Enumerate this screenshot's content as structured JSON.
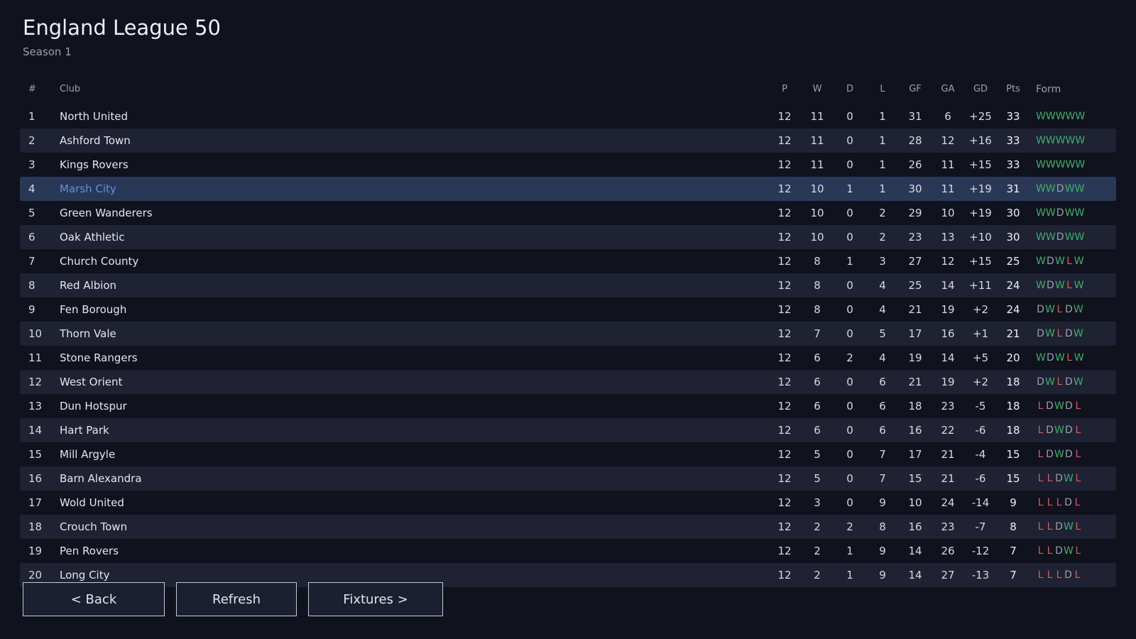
{
  "header": {
    "title": "England League 50",
    "subtitle": "Season 1"
  },
  "columns": {
    "pos": "#",
    "club": "Club",
    "p": "P",
    "w": "W",
    "d": "D",
    "l": "L",
    "gf": "GF",
    "ga": "GA",
    "gd": "GD",
    "pts": "Pts",
    "form": "Form"
  },
  "highlight_club": "Marsh City",
  "rows": [
    {
      "pos": "1",
      "club": "North United",
      "p": "12",
      "w": "11",
      "d": "0",
      "l": "1",
      "gf": "31",
      "ga": "6",
      "gd": "+25",
      "pts": "33",
      "form": "WWWWW"
    },
    {
      "pos": "2",
      "club": "Ashford Town",
      "p": "12",
      "w": "11",
      "d": "0",
      "l": "1",
      "gf": "28",
      "ga": "12",
      "gd": "+16",
      "pts": "33",
      "form": "WWWWW"
    },
    {
      "pos": "3",
      "club": "Kings Rovers",
      "p": "12",
      "w": "11",
      "d": "0",
      "l": "1",
      "gf": "26",
      "ga": "11",
      "gd": "+15",
      "pts": "33",
      "form": "WWWWW"
    },
    {
      "pos": "4",
      "club": "Marsh City",
      "p": "12",
      "w": "10",
      "d": "1",
      "l": "1",
      "gf": "30",
      "ga": "11",
      "gd": "+19",
      "pts": "31",
      "form": "WWDWW"
    },
    {
      "pos": "5",
      "club": "Green Wanderers",
      "p": "12",
      "w": "10",
      "d": "0",
      "l": "2",
      "gf": "29",
      "ga": "10",
      "gd": "+19",
      "pts": "30",
      "form": "WWDWW"
    },
    {
      "pos": "6",
      "club": "Oak Athletic",
      "p": "12",
      "w": "10",
      "d": "0",
      "l": "2",
      "gf": "23",
      "ga": "13",
      "gd": "+10",
      "pts": "30",
      "form": "WWDWW"
    },
    {
      "pos": "7",
      "club": "Church County",
      "p": "12",
      "w": "8",
      "d": "1",
      "l": "3",
      "gf": "27",
      "ga": "12",
      "gd": "+15",
      "pts": "25",
      "form": "WDWLW"
    },
    {
      "pos": "8",
      "club": "Red Albion",
      "p": "12",
      "w": "8",
      "d": "0",
      "l": "4",
      "gf": "25",
      "ga": "14",
      "gd": "+11",
      "pts": "24",
      "form": "WDWLW"
    },
    {
      "pos": "9",
      "club": "Fen Borough",
      "p": "12",
      "w": "8",
      "d": "0",
      "l": "4",
      "gf": "21",
      "ga": "19",
      "gd": "+2",
      "pts": "24",
      "form": "DWLDW"
    },
    {
      "pos": "10",
      "club": "Thorn Vale",
      "p": "12",
      "w": "7",
      "d": "0",
      "l": "5",
      "gf": "17",
      "ga": "16",
      "gd": "+1",
      "pts": "21",
      "form": "DWLDW"
    },
    {
      "pos": "11",
      "club": "Stone Rangers",
      "p": "12",
      "w": "6",
      "d": "2",
      "l": "4",
      "gf": "19",
      "ga": "14",
      "gd": "+5",
      "pts": "20",
      "form": "WDWLW"
    },
    {
      "pos": "12",
      "club": "West Orient",
      "p": "12",
      "w": "6",
      "d": "0",
      "l": "6",
      "gf": "21",
      "ga": "19",
      "gd": "+2",
      "pts": "18",
      "form": "DWLDW"
    },
    {
      "pos": "13",
      "club": "Dun Hotspur",
      "p": "12",
      "w": "6",
      "d": "0",
      "l": "6",
      "gf": "18",
      "ga": "23",
      "gd": "-5",
      "pts": "18",
      "form": "LDWDL"
    },
    {
      "pos": "14",
      "club": "Hart Park",
      "p": "12",
      "w": "6",
      "d": "0",
      "l": "6",
      "gf": "16",
      "ga": "22",
      "gd": "-6",
      "pts": "18",
      "form": "LDWDL"
    },
    {
      "pos": "15",
      "club": "Mill Argyle",
      "p": "12",
      "w": "5",
      "d": "0",
      "l": "7",
      "gf": "17",
      "ga": "21",
      "gd": "-4",
      "pts": "15",
      "form": "LDWDL"
    },
    {
      "pos": "16",
      "club": "Barn Alexandra",
      "p": "12",
      "w": "5",
      "d": "0",
      "l": "7",
      "gf": "15",
      "ga": "21",
      "gd": "-6",
      "pts": "15",
      "form": "LLDWL"
    },
    {
      "pos": "17",
      "club": "Wold United",
      "p": "12",
      "w": "3",
      "d": "0",
      "l": "9",
      "gf": "10",
      "ga": "24",
      "gd": "-14",
      "pts": "9",
      "form": "LLLDL"
    },
    {
      "pos": "18",
      "club": "Crouch Town",
      "p": "12",
      "w": "2",
      "d": "2",
      "l": "8",
      "gf": "16",
      "ga": "23",
      "gd": "-7",
      "pts": "8",
      "form": "LLDWL"
    },
    {
      "pos": "19",
      "club": "Pen Rovers",
      "p": "12",
      "w": "2",
      "d": "1",
      "l": "9",
      "gf": "14",
      "ga": "26",
      "gd": "-12",
      "pts": "7",
      "form": "LLDWL"
    },
    {
      "pos": "20",
      "club": "Long City",
      "p": "12",
      "w": "2",
      "d": "1",
      "l": "9",
      "gf": "14",
      "ga": "27",
      "gd": "-13",
      "pts": "7",
      "form": "LLLDL"
    }
  ],
  "form_colors": {
    "W": "#3fae6a",
    "D": "#9aa0ae",
    "L": "#d55b5b"
  },
  "highlight_color": "#2a3858",
  "buttons": {
    "back": "< Back",
    "refresh": "Refresh",
    "fixtures": "Fixtures  >"
  }
}
